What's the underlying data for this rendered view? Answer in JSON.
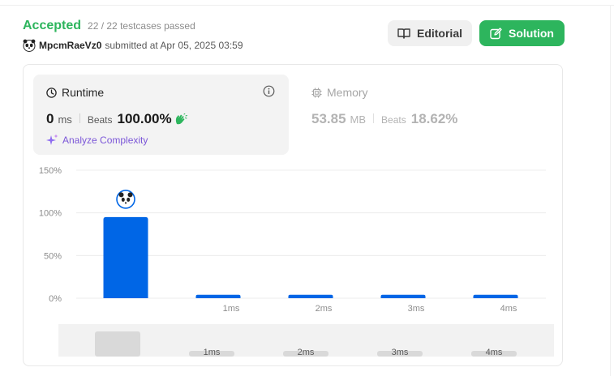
{
  "header": {
    "status": "Accepted",
    "testcases": "22 / 22 testcases passed",
    "username": "MpcmRaeVz0",
    "submitted_text": "submitted at Apr 05, 2025 03:59"
  },
  "buttons": {
    "editorial": "Editorial",
    "solution": "Solution"
  },
  "runtime": {
    "title": "Runtime",
    "value": "0",
    "unit": "ms",
    "beats_label": "Beats",
    "beats_value": "100.00%",
    "analyze": "Analyze Complexity"
  },
  "memory": {
    "title": "Memory",
    "value": "53.85",
    "unit": "MB",
    "beats_label": "Beats",
    "beats_value": "18.62%"
  },
  "colors": {
    "accepted": "#2db55d",
    "bar": "#0066e6",
    "analyze": "#7b56d8"
  },
  "chart_data": {
    "type": "bar",
    "categories": [
      "0ms",
      "1ms",
      "2ms",
      "3ms",
      "4ms"
    ],
    "category_labels": [
      "",
      "1ms",
      "2ms",
      "3ms",
      "4ms"
    ],
    "values": [
      95,
      4,
      4,
      4,
      4
    ],
    "y_ticks": [
      "150%",
      "100%",
      "50%",
      "0%"
    ],
    "y_tick_values": [
      150,
      100,
      50,
      0
    ],
    "ylim": [
      0,
      150
    ],
    "highlight_index": 0,
    "grid": true
  },
  "navigator": {
    "labels": [
      "1ms",
      "2ms",
      "3ms",
      "4ms"
    ]
  }
}
